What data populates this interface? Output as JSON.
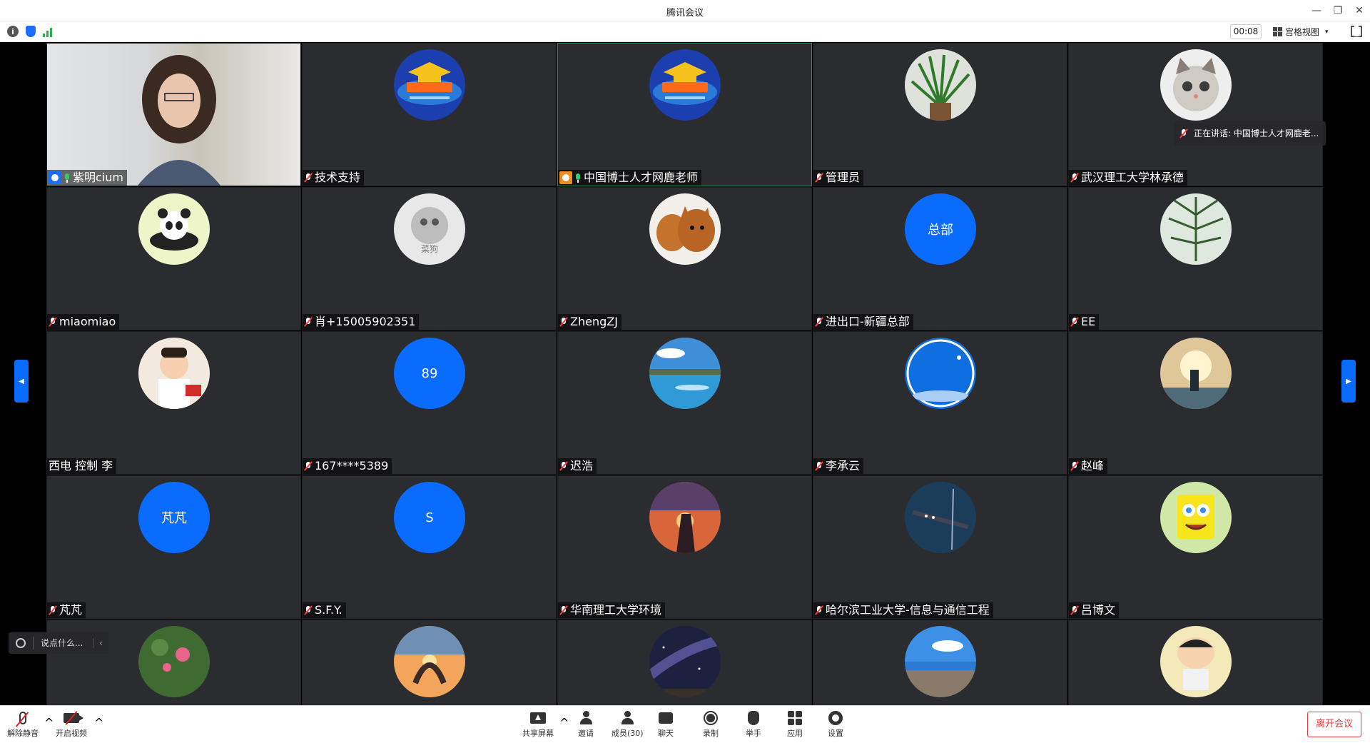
{
  "window": {
    "title": "腾讯会议"
  },
  "topbar": {
    "timer": "00:08",
    "view_mode": "宫格视图"
  },
  "speaking": {
    "label": "正在讲话: 中国博士人才网鹿老..."
  },
  "chat": {
    "placeholder": "说点什么..."
  },
  "participants": [
    {
      "name": "紫明cium",
      "kind": "video",
      "mic": "on",
      "badge": "host"
    },
    {
      "name": "技术支持",
      "kind": "logo",
      "mic": "off"
    },
    {
      "name": "中国博士人才网鹿老师",
      "kind": "logo",
      "mic": "on",
      "badge": "cohost",
      "active": true
    },
    {
      "name": "管理员",
      "kind": "plant",
      "mic": "off"
    },
    {
      "name": "武汉理工大学林承德",
      "kind": "cat",
      "mic": "off"
    },
    {
      "name": "miaomiao",
      "kind": "panda",
      "mic": "off"
    },
    {
      "name": "肖+15005902351",
      "kind": "sketch",
      "mic": "off"
    },
    {
      "name": "ZhengZJ",
      "kind": "dogs",
      "mic": "off"
    },
    {
      "name": "进出口-新疆总部",
      "kind": "text",
      "avatar_text": "总部",
      "mic": "off"
    },
    {
      "name": "EE",
      "kind": "pine",
      "mic": "off"
    },
    {
      "name": "西电 控制 李",
      "kind": "baby",
      "mic": "none"
    },
    {
      "name": "167****5389",
      "kind": "text",
      "avatar_text": "89",
      "mic": "off"
    },
    {
      "name": "迟浩",
      "kind": "lake",
      "mic": "off"
    },
    {
      "name": "李承云",
      "kind": "sky",
      "mic": "off"
    },
    {
      "name": "赵峰",
      "kind": "hero",
      "mic": "off"
    },
    {
      "name": "芃芃",
      "kind": "text",
      "avatar_text": "芃芃",
      "mic": "off"
    },
    {
      "name": "S.F.Y.",
      "kind": "text",
      "avatar_text": "S",
      "mic": "off"
    },
    {
      "name": "华南理工大学环境",
      "kind": "sunset",
      "mic": "off"
    },
    {
      "name": "哈尔滨工业大学-信息与通信工程",
      "kind": "bridge",
      "mic": "off"
    },
    {
      "name": "吕博文",
      "kind": "sponge",
      "mic": "off"
    },
    {
      "name": "",
      "kind": "flowers",
      "mic": "none"
    },
    {
      "name": "",
      "kind": "heart",
      "mic": "none"
    },
    {
      "name": "",
      "kind": "galaxy",
      "mic": "none"
    },
    {
      "name": "",
      "kind": "beach",
      "mic": "none"
    },
    {
      "name": "",
      "kind": "shin",
      "mic": "none"
    }
  ],
  "toolbar": {
    "unmute": "解除静音",
    "start_video": "开启视频",
    "share": "共享屏幕",
    "invite": "邀请",
    "members": "成员(30)",
    "chat": "聊天",
    "record": "录制",
    "raise_hand": "举手",
    "apps": "应用",
    "settings": "设置",
    "leave": "离开会议"
  }
}
